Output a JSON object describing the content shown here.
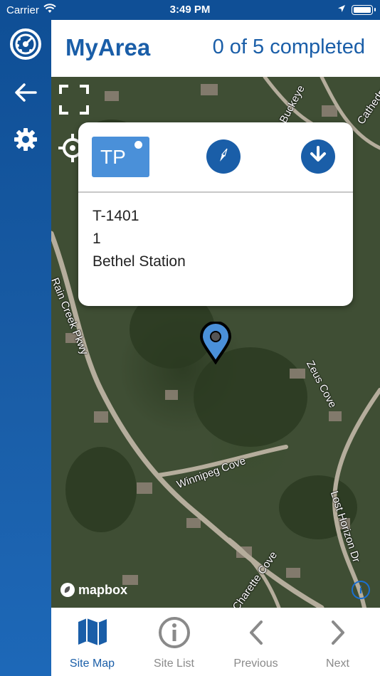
{
  "status_bar": {
    "carrier": "Carrier",
    "time": "3:49 PM",
    "icons": [
      "wifi-icon",
      "location-arrow-icon",
      "battery-icon"
    ]
  },
  "sidebar": {
    "items": [
      {
        "icon": "dashboard-gauge-icon"
      },
      {
        "icon": "back-arrow-icon"
      },
      {
        "icon": "gear-icon"
      }
    ]
  },
  "header": {
    "title": "MyArea",
    "progress": "0 of 5 completed"
  },
  "map": {
    "controls": [
      "fullscreen-icon",
      "locate-crosshair-icon"
    ],
    "street_labels": [
      "Rain Creek Pkwy",
      "Winnipeg Cove",
      "Zeus Cove",
      "Lost Horizon Dr",
      "Buckeye",
      "Cathedral",
      "Charette Cove"
    ],
    "attribution": "mapbox",
    "info_symbol": "i"
  },
  "popup": {
    "badge": "TP",
    "line1": "T-1401",
    "line2": "1",
    "line3": "Bethel Station",
    "actions": [
      "compass-icon",
      "download-icon"
    ]
  },
  "tabs": [
    {
      "label": "Site Map",
      "icon": "map-icon",
      "active": true
    },
    {
      "label": "Site List",
      "icon": "info-circle-icon",
      "active": false
    },
    {
      "label": "Previous",
      "icon": "chevron-left-icon",
      "active": false
    },
    {
      "label": "Next",
      "icon": "chevron-right-icon",
      "active": false
    }
  ],
  "colors": {
    "brand_blue": "#1a5ea8",
    "badge_blue": "#4a90d9",
    "inactive_gray": "#8a8a8a"
  }
}
